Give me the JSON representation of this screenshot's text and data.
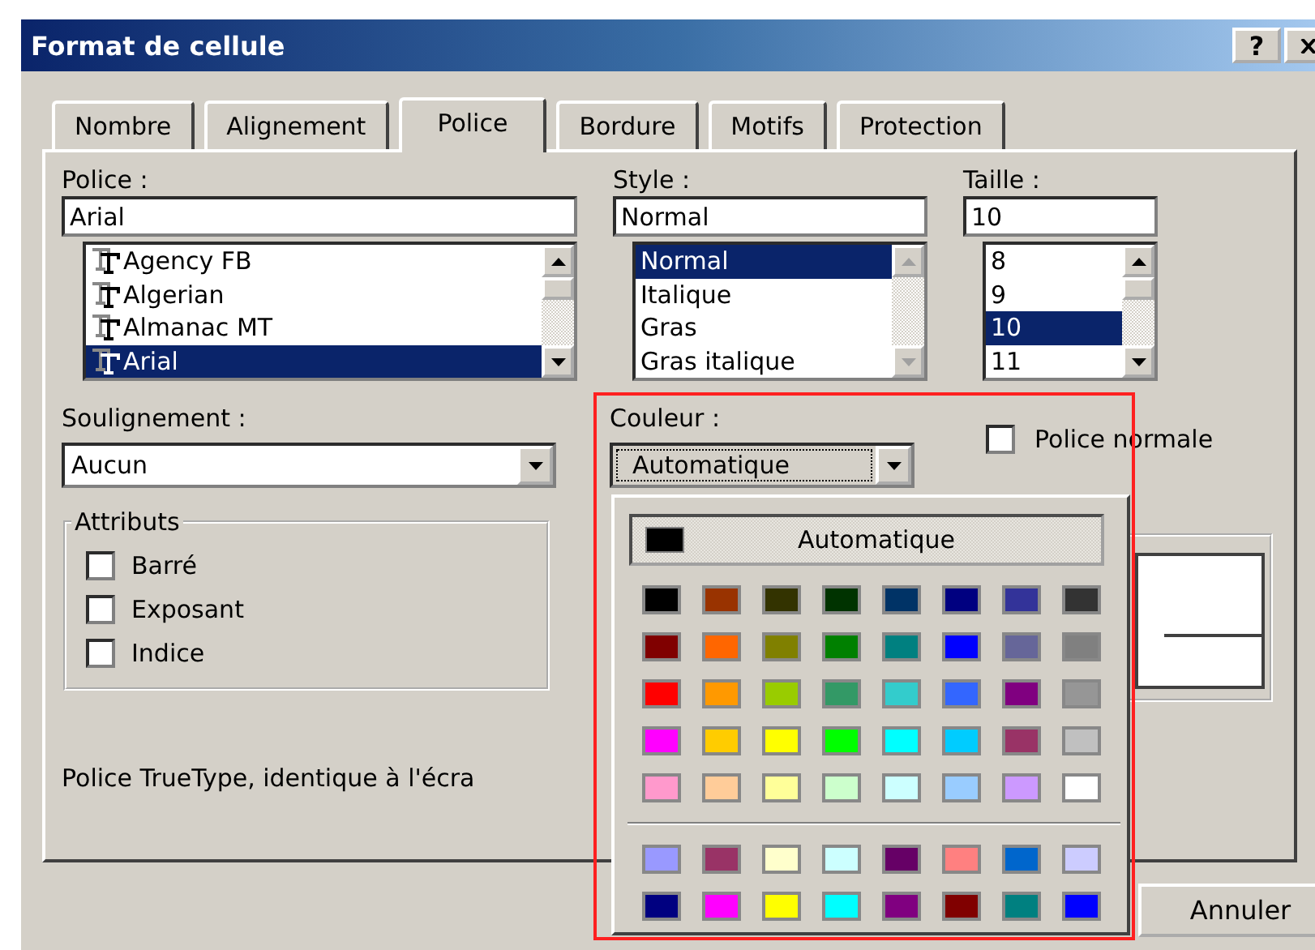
{
  "window": {
    "title": "Format de cellule",
    "help": "?"
  },
  "tabs": [
    {
      "label": "Nombre",
      "selected": false
    },
    {
      "label": "Alignement",
      "selected": false
    },
    {
      "label": "Police",
      "selected": true
    },
    {
      "label": "Bordure",
      "selected": false
    },
    {
      "label": "Motifs",
      "selected": false
    },
    {
      "label": "Protection",
      "selected": false
    }
  ],
  "font": {
    "label": "Police :",
    "value": "Arial",
    "items": [
      {
        "label": "Agency FB",
        "selected": false
      },
      {
        "label": "Algerian",
        "selected": false
      },
      {
        "label": "Almanac MT",
        "selected": false
      },
      {
        "label": "Arial",
        "selected": true
      }
    ]
  },
  "style": {
    "label": "Style :",
    "value": "Normal",
    "scroll_disabled": true,
    "items": [
      {
        "label": "Normal",
        "selected": true
      },
      {
        "label": "Italique",
        "selected": false
      },
      {
        "label": "Gras",
        "selected": false
      },
      {
        "label": "Gras italique",
        "selected": false
      }
    ]
  },
  "size": {
    "label": "Taille :",
    "value": "10",
    "scroll_disabled": false,
    "items": [
      {
        "label": "8",
        "selected": false
      },
      {
        "label": "9",
        "selected": false
      },
      {
        "label": "10",
        "selected": true
      },
      {
        "label": "11",
        "selected": false
      }
    ]
  },
  "underline": {
    "label": "Soulignement :",
    "value": "Aucun"
  },
  "color": {
    "label": "Couleur :",
    "value": "Automatique"
  },
  "normal_font": {
    "label": "Police normale",
    "checked": false
  },
  "attributes": {
    "label": "Attributs",
    "items": [
      {
        "label": "Barré",
        "checked": false
      },
      {
        "label": "Exposant",
        "checked": false
      },
      {
        "label": "Indice",
        "checked": false
      }
    ]
  },
  "description": "Police TrueType, identique à l'écra",
  "color_popup": {
    "automatic": "Automatique",
    "swatches": [
      {
        "color": "#000000"
      },
      {
        "color": "#993300"
      },
      {
        "color": "#333300"
      },
      {
        "color": "#003300"
      },
      {
        "color": "#003366"
      },
      {
        "color": "#000080"
      },
      {
        "color": "#333399"
      },
      {
        "color": "#333333"
      },
      {
        "color": "#800000"
      },
      {
        "color": "#ff6600"
      },
      {
        "color": "#808000"
      },
      {
        "color": "#008000"
      },
      {
        "color": "#008080"
      },
      {
        "color": "#0000ff"
      },
      {
        "color": "#666699"
      },
      {
        "color": "#808080"
      },
      {
        "color": "#ff0000"
      },
      {
        "color": "#ff9900"
      },
      {
        "color": "#99cc00"
      },
      {
        "color": "#339966"
      },
      {
        "color": "#33cccc"
      },
      {
        "color": "#3366ff"
      },
      {
        "color": "#800080"
      },
      {
        "color": "#969696"
      },
      {
        "color": "#ff00ff"
      },
      {
        "color": "#ffcc00"
      },
      {
        "color": "#ffff00"
      },
      {
        "color": "#00ff00"
      },
      {
        "color": "#00ffff"
      },
      {
        "color": "#00ccff"
      },
      {
        "color": "#993366"
      },
      {
        "color": "#c0c0c0"
      },
      {
        "color": "#ff99cc"
      },
      {
        "color": "#ffcc99"
      },
      {
        "color": "#ffff99"
      },
      {
        "color": "#ccffcc"
      },
      {
        "color": "#ccffff"
      },
      {
        "color": "#99ccff"
      },
      {
        "color": "#cc99ff"
      },
      {
        "color": "#ffffff"
      }
    ],
    "chart_swatches": [
      {
        "color": "#9999ff"
      },
      {
        "color": "#993366"
      },
      {
        "color": "#ffffcc"
      },
      {
        "color": "#ccffff"
      },
      {
        "color": "#660066"
      },
      {
        "color": "#ff8080"
      },
      {
        "color": "#0066cc"
      },
      {
        "color": "#ccccff"
      },
      {
        "color": "#000080"
      },
      {
        "color": "#ff00ff"
      },
      {
        "color": "#ffff00"
      },
      {
        "color": "#00ffff"
      },
      {
        "color": "#800080"
      },
      {
        "color": "#800000"
      },
      {
        "color": "#008080"
      },
      {
        "color": "#0000ff"
      }
    ]
  },
  "buttons": [
    {
      "label": "Annuler"
    }
  ]
}
